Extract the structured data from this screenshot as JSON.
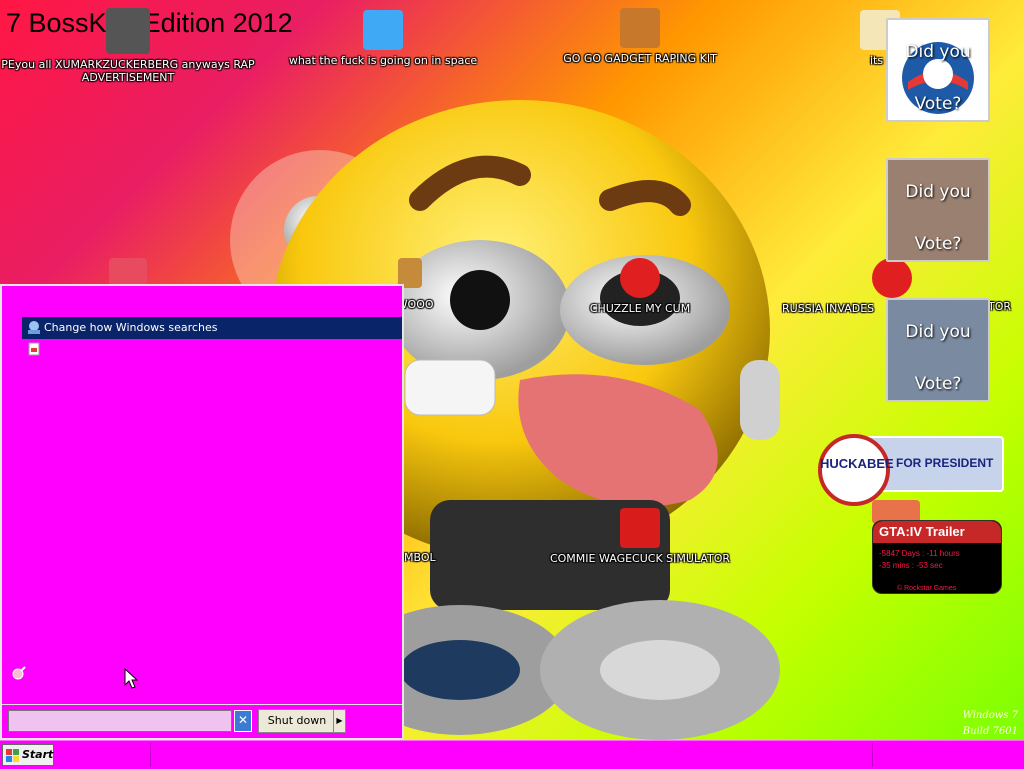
{
  "desktop": {
    "title": "7 BossKi   e Edition 2012",
    "icons": [
      {
        "label": "PEyou all XUMARKZUCKERBERG anyways RAP ADVERTISEMENT",
        "color": "#555555"
      },
      {
        "label": "what the fuck is going on in space",
        "color": "#3fa9f5"
      },
      {
        "label": "GO GO GADGET RAPING KIT",
        "color": "#c8782a"
      },
      {
        "label": "its c",
        "color": "#f5e6b8"
      },
      {
        "label": "Y WOOO",
        "color": "#c58b3a"
      },
      {
        "label": "CHUZZLE MY CUM",
        "color": "#e02020"
      },
      {
        "label": "RUSSIA INVADES",
        "color": "#e02020"
      },
      {
        "label": "TOR",
        "color": "#888888"
      },
      {
        "label": "MBOL",
        "color": "#888888"
      },
      {
        "label": "COMMIE WAGECUCK SIMULATOR",
        "color": "#d81b1b"
      }
    ],
    "build": {
      "line1": "Windows 7",
      "line2": "Build 7601"
    }
  },
  "gadgets": {
    "vote1": {
      "did": "Did you",
      "vote": "Vote?"
    },
    "vote2": {
      "did": "Did you",
      "vote": "Vote?"
    },
    "vote3": {
      "did": "Did you",
      "vote": "Vote?"
    },
    "huckabee": {
      "name": "HUCKABEE",
      "tag": "FOR PRESIDENT"
    },
    "gta": {
      "title": "GTA:IV Trailer",
      "line1": "-5847 Days : -11 hours",
      "line2": "-35 mins : -53 sec",
      "footer": "© Rockstar Games"
    }
  },
  "start_menu": {
    "selected_item": "Change how Windows searches",
    "search_placeholder": "",
    "shutdown_label": "Shut down"
  },
  "taskbar": {
    "start_label": "Start"
  },
  "colors": {
    "start_menu_bg": "#ff00ff",
    "selected": "#0a246a"
  }
}
